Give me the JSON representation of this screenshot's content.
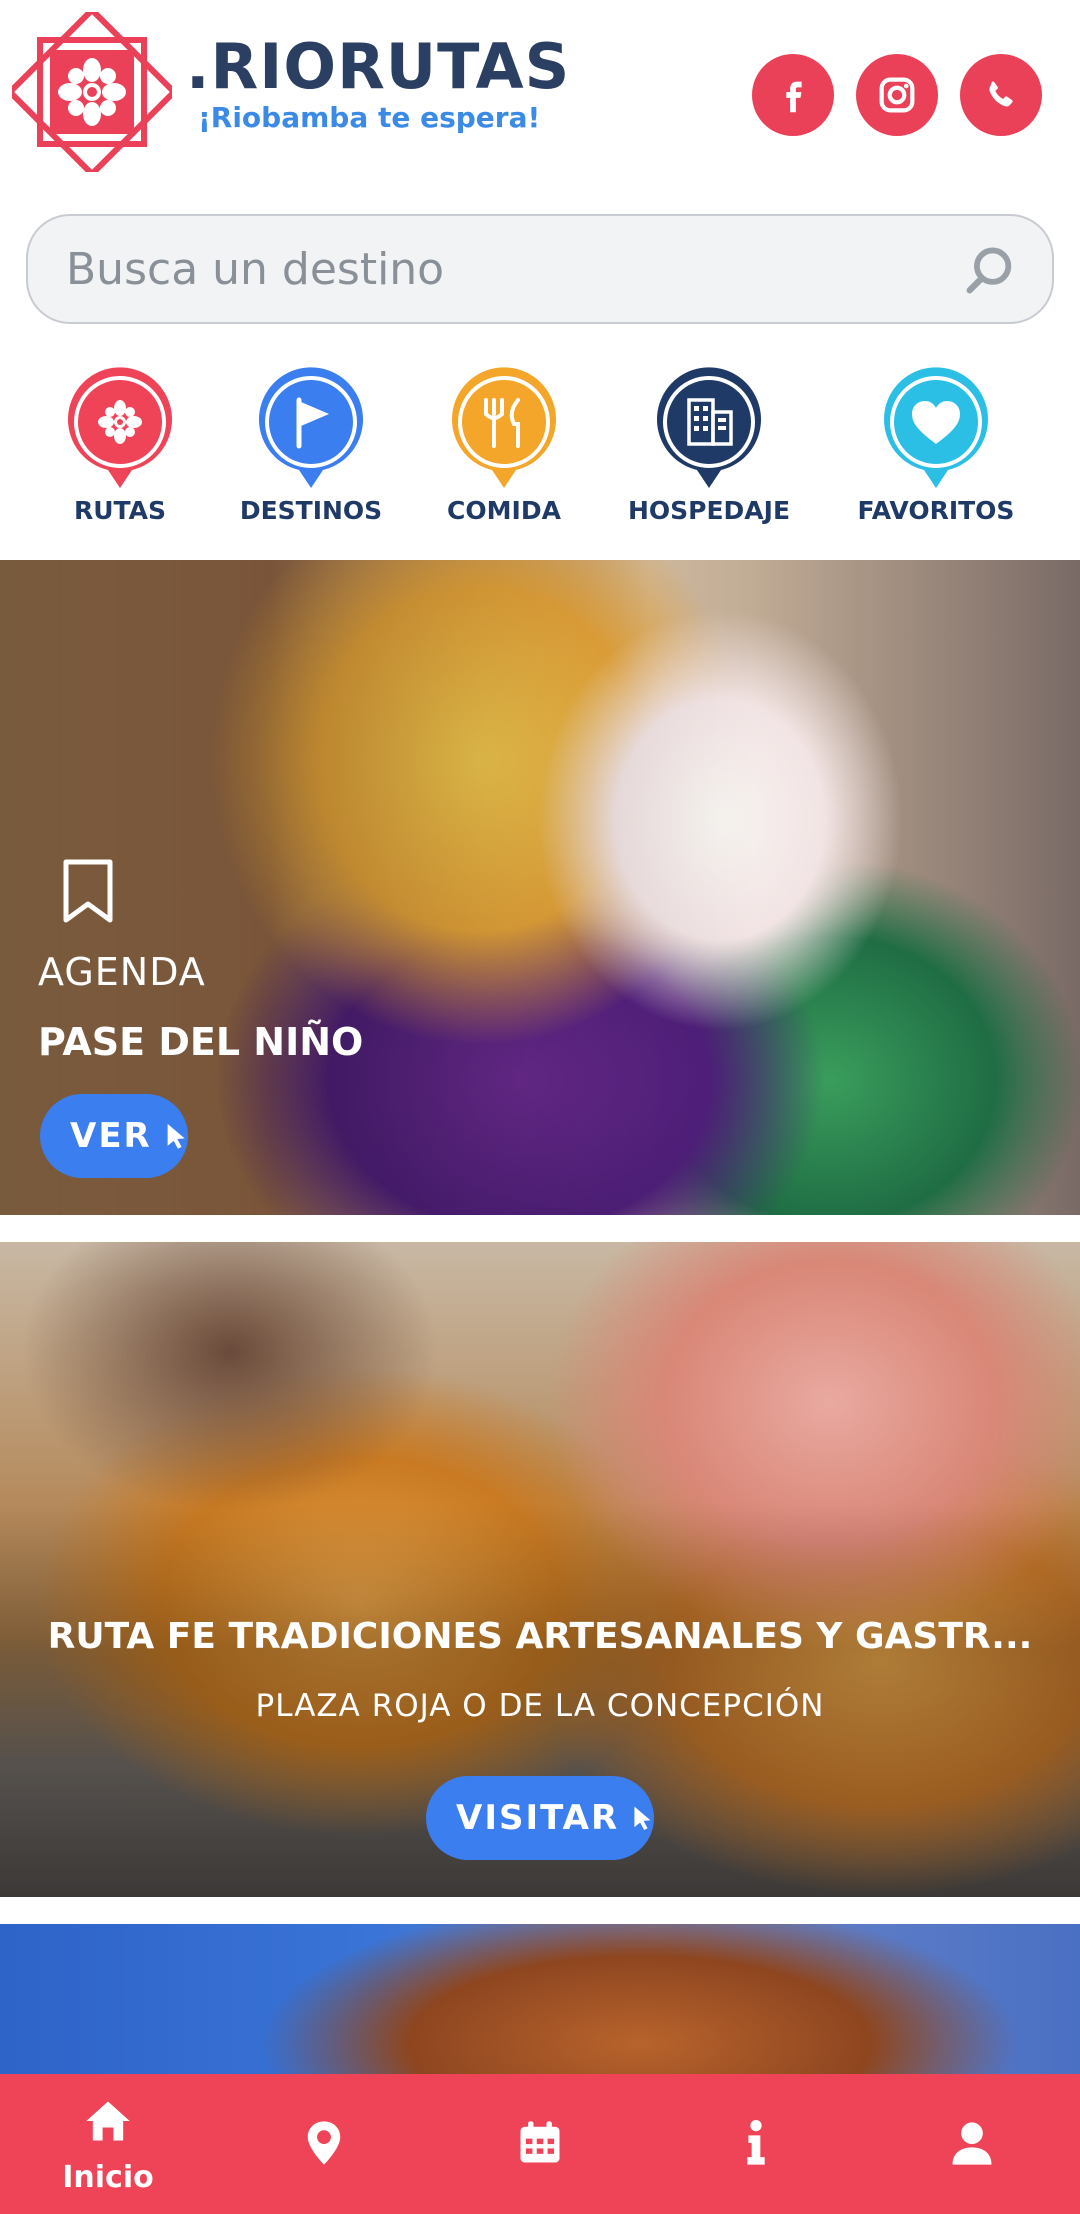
{
  "header": {
    "brand_title": ".RIORUTAS",
    "brand_tagline": "¡Riobamba te espera!",
    "social": [
      {
        "icon": "facebook-icon"
      },
      {
        "icon": "instagram-icon"
      },
      {
        "icon": "whatsapp-icon"
      }
    ]
  },
  "search": {
    "placeholder": "Busca un destino",
    "value": ""
  },
  "categories": [
    {
      "label": "RUTAS",
      "icon": "flower-icon",
      "color": "#ef4358"
    },
    {
      "label": "DESTINOS",
      "icon": "flag-icon",
      "color": "#3b7ef0"
    },
    {
      "label": "COMIDA",
      "icon": "fork-knife-icon",
      "color": "#f4a62a"
    },
    {
      "label": "HOSPEDAJE",
      "icon": "building-icon",
      "color": "#1f3a66"
    },
    {
      "label": "FAVORITOS",
      "icon": "heart-icon",
      "color": "#2bbfe6"
    }
  ],
  "cards": [
    {
      "kicker": "AGENDA",
      "title": "PASE DEL NIÑO",
      "button": "VER"
    },
    {
      "title": "RUTA FE TRADICIONES ARTESANALES Y GASTR...",
      "subtitle": "PLAZA ROJA O DE LA CONCEPCIÓN",
      "button": "VISITAR"
    }
  ],
  "bottom_nav": {
    "items": [
      {
        "icon": "home-icon",
        "label": "Inicio"
      },
      {
        "icon": "map-pin-icon",
        "label": ""
      },
      {
        "icon": "calendar-icon",
        "label": ""
      },
      {
        "icon": "info-icon",
        "label": ""
      },
      {
        "icon": "user-icon",
        "label": ""
      }
    ]
  },
  "colors": {
    "brand_red": "#ef4358",
    "brand_navy": "#2b3f63",
    "accent_blue": "#3b7ef0"
  }
}
